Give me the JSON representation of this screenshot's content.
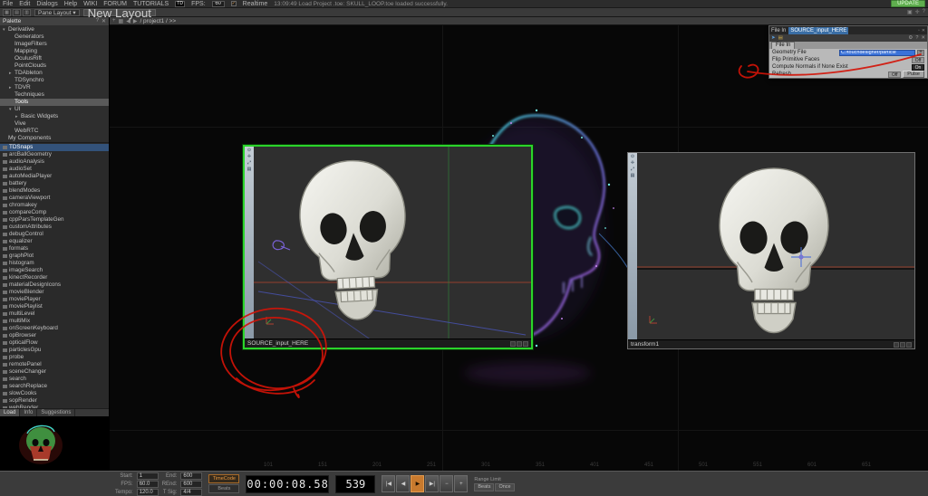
{
  "colors": {
    "selection_green": "#2bd42b",
    "annotation_red": "#d21408",
    "selection_blue": "#3a6ea5",
    "play_orange": "#c87a2e",
    "particle_teal": "#3fe8de",
    "particle_magenta": "#c052d8"
  },
  "menubar": {
    "menus": [
      "File",
      "Edit",
      "Dialogs",
      "Help",
      "WIKI"
    ],
    "links": [
      "FORUM",
      "TUTORIALS"
    ],
    "logo": "TD",
    "fps_label": "FPS:",
    "fps_value": "60",
    "realtime_label": "Realtime",
    "realtime_check": "✓",
    "status": "13:09:49 Load Project .toe: SKULL_LOOP.toe loaded successfully.",
    "update_label": "UPDATE"
  },
  "toolbar": {
    "pane_icons": [
      "▦",
      "▤",
      "▥"
    ],
    "pane_layout_label": "Pane Layout",
    "dropdown_arrow": "▾",
    "new_layout_label": "New Layout",
    "right_icons": [
      "▣",
      "✛",
      "?"
    ]
  },
  "palette": {
    "title": "Palette",
    "help_icon": "?",
    "close_icon": "✕",
    "tree": [
      {
        "arrow": "▾",
        "label": "Derivative",
        "class": "ind0"
      },
      {
        "arrow": "",
        "label": "Generators",
        "class": "ind1"
      },
      {
        "arrow": "",
        "label": "ImageFilters",
        "class": "ind1"
      },
      {
        "arrow": "",
        "label": "Mapping",
        "class": "ind1"
      },
      {
        "arrow": "",
        "label": "OculusRift",
        "class": "ind1"
      },
      {
        "arrow": "",
        "label": "PointClouds",
        "class": "ind1"
      },
      {
        "arrow": "▸",
        "label": "TDAbleton",
        "class": "ind1"
      },
      {
        "arrow": "",
        "label": "TDSynchro",
        "class": "ind1"
      },
      {
        "arrow": "▸",
        "label": "TDVR",
        "class": "ind1"
      },
      {
        "arrow": "",
        "label": "Techniques",
        "class": "ind1"
      },
      {
        "arrow": "",
        "label": "Tools",
        "class": "ind1 sel"
      },
      {
        "arrow": "▾",
        "label": "UI",
        "class": "ind1"
      },
      {
        "arrow": "▸",
        "label": "Basic Widgets",
        "class": "ind2"
      },
      {
        "arrow": "",
        "label": "Vive",
        "class": "ind1"
      },
      {
        "arrow": "",
        "label": "WebRTC",
        "class": "ind1"
      },
      {
        "arrow": "",
        "label": "My Components",
        "class": "ind0"
      }
    ],
    "operators": [
      {
        "label": "TDSnaps",
        "class": "sel"
      },
      {
        "label": "arcBallGeometry"
      },
      {
        "label": "audioAnalysis"
      },
      {
        "label": "audioSet"
      },
      {
        "label": "autoMediaPlayer"
      },
      {
        "label": "battery"
      },
      {
        "label": "blendModes"
      },
      {
        "label": "cameraViewport"
      },
      {
        "label": "chromakey"
      },
      {
        "label": "compareComp"
      },
      {
        "label": "cppParsTemplateGen"
      },
      {
        "label": "customAttributes"
      },
      {
        "label": "debugControl"
      },
      {
        "label": "equalizer"
      },
      {
        "label": "formats"
      },
      {
        "label": "graphPlot"
      },
      {
        "label": "histogram"
      },
      {
        "label": "imageSearch"
      },
      {
        "label": "kinectRecorder"
      },
      {
        "label": "materialDesignIcons"
      },
      {
        "label": "movieBlender"
      },
      {
        "label": "moviePlayer"
      },
      {
        "label": "moviePlaylist"
      },
      {
        "label": "multiLevel"
      },
      {
        "label": "multiMix"
      },
      {
        "label": "onScreenKeyboard"
      },
      {
        "label": "opBrowser"
      },
      {
        "label": "opticalFlow"
      },
      {
        "label": "particlesGpu"
      },
      {
        "label": "probe"
      },
      {
        "label": "remotePanel"
      },
      {
        "label": "sceneChanger"
      },
      {
        "label": "search"
      },
      {
        "label": "searchReplace"
      },
      {
        "label": "slowCooks"
      },
      {
        "label": "sopRender"
      },
      {
        "label": "webRender"
      }
    ],
    "tabs": [
      {
        "label": "Load",
        "class": "active"
      },
      {
        "label": "Info"
      },
      {
        "label": "Suggestions"
      }
    ]
  },
  "network": {
    "breadcrumb_icons": [
      "+",
      "▦",
      "◀",
      "▶"
    ],
    "breadcrumb_path": "/ project1 / >>",
    "ruler": [
      "101",
      "151",
      "201",
      "251",
      "301",
      "351",
      "401",
      "451",
      "501",
      "551",
      "601",
      "651"
    ],
    "viewer_strip_icons": [
      "⊙",
      "✛",
      "⤢",
      "▤"
    ],
    "viewer_left": {
      "name": "SOURCE_input_HERE"
    },
    "viewer_right": {
      "name": "transform1"
    },
    "param_dialog": {
      "window_title": "File In",
      "op_name": "SOURCE_input_HERE",
      "title_icons": [
        "▫",
        "✕"
      ],
      "icons_left": [
        "➤",
        "▤"
      ],
      "icons_right": [
        "⚙",
        "?",
        "✕"
      ],
      "page_tab": "File In",
      "rows": {
        "file_label": "Geometry File",
        "file_value": "C:/touchdesigner/particle",
        "plus_label": "+",
        "flip_label": "Flip Primitive Faces",
        "flip_value": "Off",
        "normals_label": "Compute Normals if None Exist",
        "normals_value": "On",
        "refresh_label": "Refresh",
        "refresh_value": "Off",
        "pulse_label": "Pulse"
      }
    }
  },
  "timeline": {
    "fields": [
      {
        "label": "Start:",
        "value": "1"
      },
      {
        "label": "End:",
        "value": "600"
      },
      {
        "label": "FPS:",
        "value": "60.0"
      },
      {
        "label": "REnd:",
        "value": "600"
      },
      {
        "label": "Tempo:",
        "value": "120.0"
      },
      {
        "label": "T Sig:",
        "value": "4/4"
      }
    ],
    "mode_timecode": "TimeCode",
    "mode_beats": "Beats",
    "timecode": "00:00:08.58",
    "frame": "539",
    "transport": [
      {
        "glyph": "|◀"
      },
      {
        "glyph": "◀"
      },
      {
        "glyph": "▶",
        "class": "active"
      },
      {
        "glyph": "▶|"
      },
      {
        "glyph": "−"
      },
      {
        "glyph": "+"
      }
    ],
    "range_label": "Range Limit",
    "range_buttons": [
      {
        "label": "Beats"
      },
      {
        "label": "Once"
      }
    ]
  }
}
